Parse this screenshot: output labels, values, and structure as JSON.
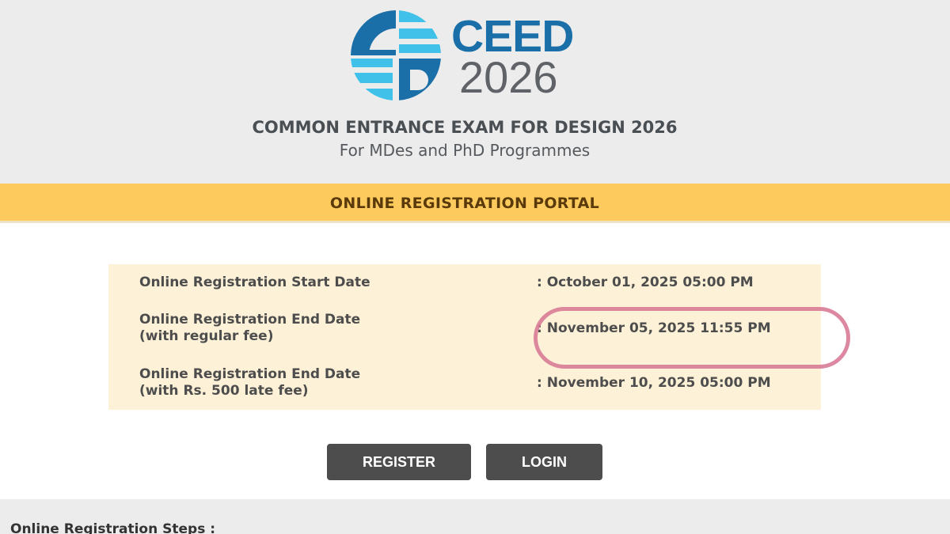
{
  "logo": {
    "name": "CEED",
    "year": "2026",
    "icon": "ceed-emblem-icon",
    "colors": {
      "dark_blue": "#1b6fa8",
      "light_blue": "#3fc1ea",
      "grey": "#5f6368"
    }
  },
  "header": {
    "title": "COMMON ENTRANCE EXAM FOR DESIGN 2026",
    "subtitle": "For MDes and PhD Programmes"
  },
  "portal": {
    "title": "ONLINE REGISTRATION PORTAL",
    "bar_color": "#fdcb5d"
  },
  "dates": [
    {
      "label_line1": "Online Registration Start Date",
      "label_line2": "",
      "value": ": October 01, 2025 05:00 PM"
    },
    {
      "label_line1": "Online Registration End Date",
      "label_line2": "(with regular fee)",
      "value": ": November 05, 2025 11:55 PM",
      "highlighted": true
    },
    {
      "label_line1": "Online Registration End Date",
      "label_line2": "(with Rs. 500 late fee)",
      "value": ": November 10, 2025 05:00 PM"
    }
  ],
  "buttons": {
    "register": "REGISTER",
    "login": "LOGIN"
  },
  "steps": {
    "title": "Online Registration Steps :"
  },
  "highlight_color": "#d97b97"
}
